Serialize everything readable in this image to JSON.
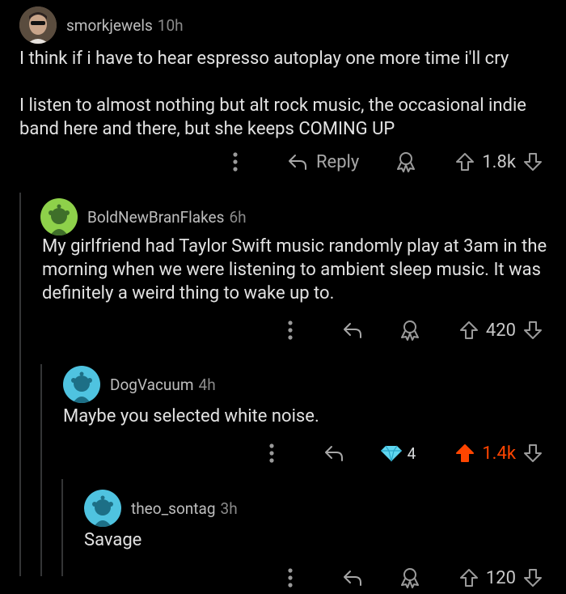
{
  "comments": [
    {
      "username": "smorkjewels",
      "age": "10h",
      "body": "I think if i have to hear espresso autoplay one more time i'll cry\n\nI listen to almost nothing but alt rock music, the occasional indie band here and there, but she keeps COMING UP",
      "reply_label": "Reply",
      "score": "1.8k",
      "vote": "none"
    },
    {
      "username": "BoldNewBranFlakes",
      "age": "6h",
      "body": "My girlfriend had Taylor Swift music randomly play at 3am in the morning when we were listening to ambient sleep music. It was definitely a weird thing to wake up to.",
      "score": "420",
      "vote": "none"
    },
    {
      "username": "DogVacuum",
      "age": "4h",
      "body": "Maybe you selected white noise.",
      "award_count": "4",
      "score": "1.4k",
      "vote": "up"
    },
    {
      "username": "theo_sontag",
      "age": "3h",
      "body": "Savage",
      "score": "120",
      "vote": "none"
    }
  ],
  "icons": [
    "more-vertical-icon",
    "reply-arrow-icon",
    "award-icon",
    "upvote-icon",
    "downvote-icon",
    "diamond-award-icon",
    "snoo-avatar-icon"
  ],
  "colors": {
    "background": "#000000",
    "upvote_active": "#ff4500",
    "avatar_green": "#8ed14a",
    "avatar_cyan": "#4fc3e0"
  }
}
